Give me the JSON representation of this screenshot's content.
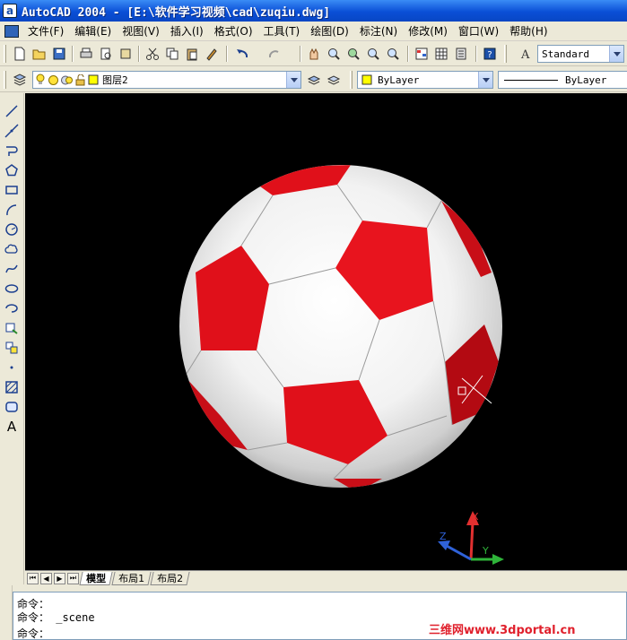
{
  "window": {
    "title": "AutoCAD 2004 - [E:\\软件学习视频\\cad\\zuqiu.dwg]"
  },
  "menu": [
    "文件(F)",
    "编辑(E)",
    "视图(V)",
    "插入(I)",
    "格式(O)",
    "工具(T)",
    "绘图(D)",
    "标注(N)",
    "修改(M)",
    "窗口(W)",
    "帮助(H)"
  ],
  "toolbar": {
    "text_style": "Standard"
  },
  "layers": {
    "current_layer": "图层2",
    "color": "ByLayer",
    "linetype": "ByLayer"
  },
  "left_toolbar": {
    "text_tool_label": "A"
  },
  "layout_tabs": [
    "模型",
    "布局1",
    "布局2"
  ],
  "ucs": {
    "x": "X",
    "y": "Y",
    "z": "Z"
  },
  "command": {
    "lines": [
      "命令：",
      "命令： _scene",
      "命令："
    ]
  },
  "watermark": "三维网www.3dportal.cn",
  "colors": {
    "viewport_bg": "#000000",
    "ball_red": "#e0101a",
    "titlebar": "#0a4fd6"
  }
}
